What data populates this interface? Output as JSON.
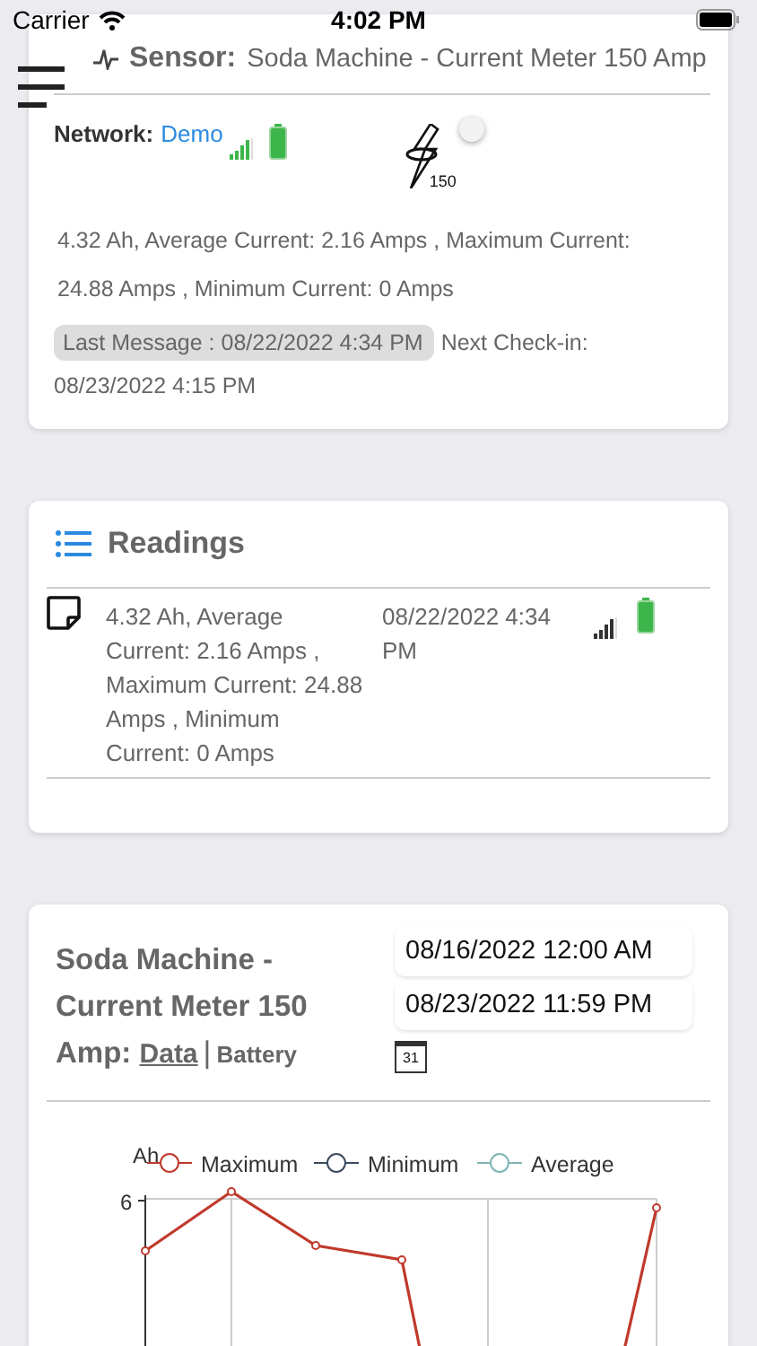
{
  "status_bar": {
    "carrier": "Carrier",
    "time": "4:02 PM"
  },
  "sensor": {
    "label": "Sensor:",
    "name": "Soda Machine - Current Meter 150 Amp",
    "network_label": "Network:",
    "network": "Demo",
    "meter_rating": "150",
    "switch": {
      "on": false
    },
    "summary": "4.32 Ah, Average Current: 2.16 Amps , Maximum Current: 24.88 Amps , Minimum Current: 0 Amps",
    "last_message": "Last Message : 08/22/2022 4:34 PM",
    "next_checkin_label": "Next Check-in:",
    "next_checkin": "08/23/2022 4:15 PM"
  },
  "readings": {
    "title": "Readings",
    "rows": [
      {
        "summary": "4.32 Ah, Average Current: 2.16 Amps , Maximum Current: 24.88 Amps , Minimum Current: 0 Amps",
        "time": "08/22/2022 4:34 PM"
      }
    ]
  },
  "chart_panel": {
    "title_lines": [
      "Soda Machine -",
      "Current Meter 150",
      "Amp:"
    ],
    "links": [
      {
        "label": "Data",
        "selected": true
      },
      {
        "label": "Battery",
        "selected": false
      }
    ],
    "separator": "|",
    "start": "08/16/2022 12:00 AM",
    "end": "08/23/2022 11:59 PM",
    "calendar_day": "31",
    "y_unit": "Ah",
    "y_tick": "6",
    "legend": [
      {
        "name": "Maximum",
        "color": "#c0392b"
      },
      {
        "name": "Minimum",
        "color": "#3c4a5e"
      },
      {
        "name": "Average",
        "color": "#7fb5b5"
      }
    ]
  }
}
